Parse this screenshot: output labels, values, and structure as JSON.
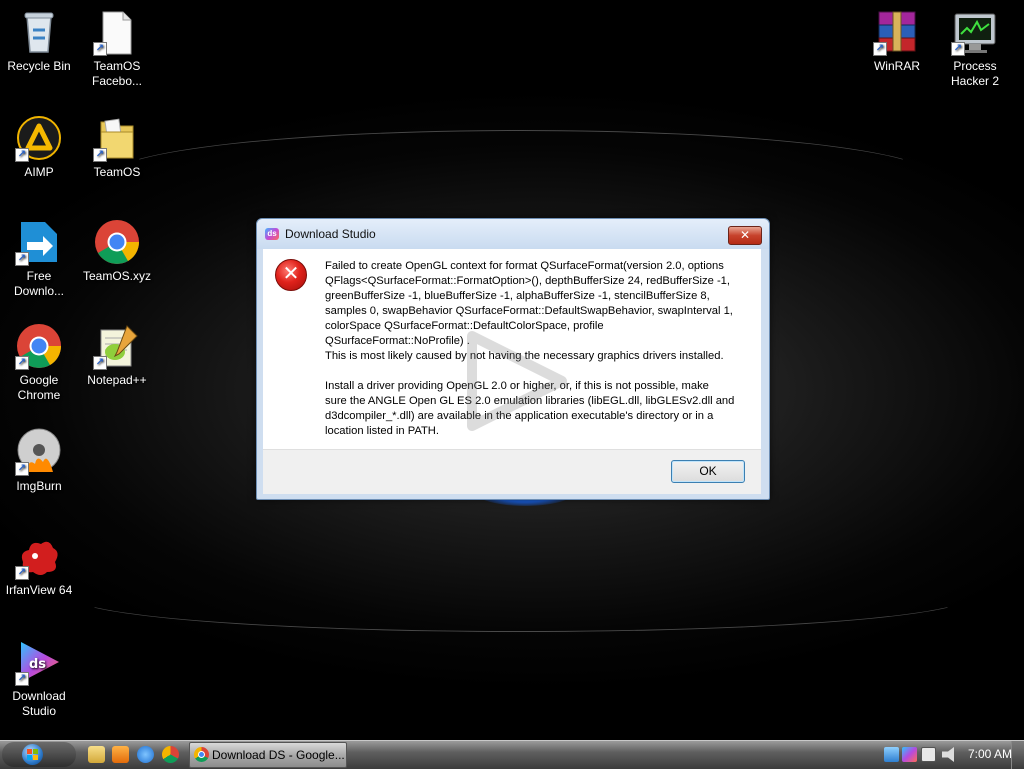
{
  "desktop": {
    "icons": [
      {
        "label_lines": [
          "Recycle Bin"
        ],
        "icon": "recycle-bin-icon"
      },
      {
        "label_lines": [
          "TeamOS",
          "Facebo..."
        ],
        "icon": "document-icon"
      },
      {
        "label_lines": [
          "AIMP"
        ],
        "icon": "aimp-icon"
      },
      {
        "label_lines": [
          "TeamOS"
        ],
        "icon": "folder-icon"
      },
      {
        "label_lines": [
          "Free",
          "Downlo..."
        ],
        "icon": "free-download-manager-icon"
      },
      {
        "label_lines": [
          "TeamOS.xyz"
        ],
        "icon": "chrome-icon"
      },
      {
        "label_lines": [
          "Google",
          "Chrome"
        ],
        "icon": "chrome-icon"
      },
      {
        "label_lines": [
          "Notepad++"
        ],
        "icon": "notepad-plus-plus-icon"
      },
      {
        "label_lines": [
          "ImgBurn"
        ],
        "icon": "imgburn-icon"
      },
      {
        "label_lines": [
          "IrfanView 64"
        ],
        "icon": "irfanview-icon"
      },
      {
        "label_lines": [
          "Download",
          "Studio"
        ],
        "icon": "download-studio-icon"
      },
      {
        "label_lines": [
          "WinRAR"
        ],
        "icon": "winrar-icon"
      },
      {
        "label_lines": [
          "Process",
          "Hacker 2"
        ],
        "icon": "process-hacker-icon"
      }
    ],
    "shortcut_glyph": "↗"
  },
  "dialog": {
    "title": "Download Studio",
    "title_icon_text": "ds",
    "close_glyph": "✕",
    "error_glyph": "✕",
    "message_lines_1": [
      "Failed to create OpenGL context for format QSurfaceFormat(version 2.0, options",
      "QFlags<QSurfaceFormat::FormatOption>(), depthBufferSize 24, redBufferSize -1,",
      "greenBufferSize -1, blueBufferSize -1, alphaBufferSize -1, stencilBufferSize 8,",
      "samples 0, swapBehavior QSurfaceFormat::DefaultSwapBehavior, swapInterval 1,",
      "colorSpace QSurfaceFormat::DefaultColorSpace, profile",
      "QSurfaceFormat::NoProfile) .",
      "This is most likely caused by not having the necessary graphics drivers installed."
    ],
    "message_lines_2": [
      "Install a driver providing OpenGL 2.0 or higher, or, if this is not possible, make",
      "sure the ANGLE Open GL ES 2.0 emulation libraries (libEGL.dll, libGLESv2.dll and",
      "d3dcompiler_*.dll) are available in the application executable's directory or in a",
      "location listed in PATH."
    ],
    "ok_label": "OK"
  },
  "taskbar": {
    "active_task_label": "Download DS - Google...",
    "clock": "7:00 AM",
    "quick_launch": [
      "explorer-icon",
      "media-player-icon",
      "internet-explorer-icon",
      "chrome-icon"
    ],
    "tray": [
      "network-icon",
      "download-studio-tray-icon",
      "display-icon",
      "volume-muted-icon"
    ]
  }
}
